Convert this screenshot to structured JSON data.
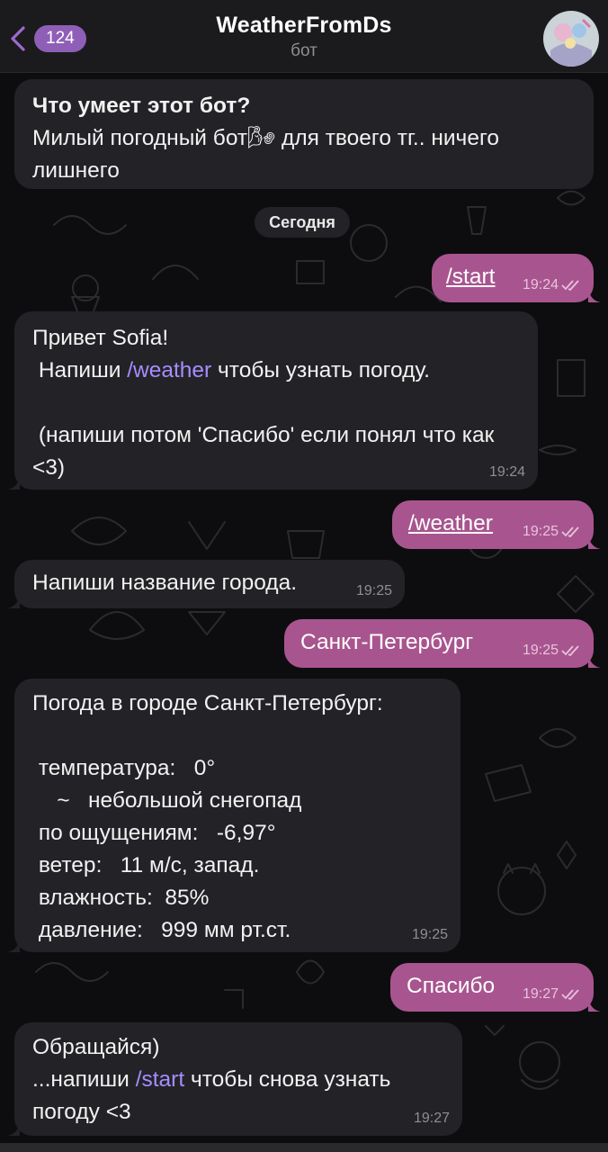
{
  "header": {
    "back_count": "124",
    "title": "WeatherFromDs",
    "subtitle": "бот"
  },
  "intro": {
    "heading": "Что умеет этот бот?",
    "text": "Милый погодный бот🌬 для твоего тг.. ничего лишнего"
  },
  "date_separator": "Сегодня",
  "messages": [
    {
      "direction": "out",
      "text": "/start",
      "time": "19:24",
      "status": "read"
    },
    {
      "direction": "in",
      "text_a": "Привет Sofia!\n Напиши ",
      "link": "/weather",
      "text_b": " чтобы узнать погоду.\n\n (напиши потом 'Спасибо' если понял что как <3)",
      "time": "19:24"
    },
    {
      "direction": "out",
      "text": "/weather",
      "time": "19:25",
      "status": "read"
    },
    {
      "direction": "in",
      "text": "Напиши название города.",
      "time": "19:25"
    },
    {
      "direction": "out",
      "text": "Санкт-Петербург",
      "time": "19:25",
      "status": "read"
    },
    {
      "direction": "in",
      "text": "Погода в городе Санкт-Петербург:\n\n температура:   0°\n    ~   небольшой снегопад\n по ощущениям:   -6,97°\n ветер:   11 м/с, запад.\n влажность:  85%\n давление:   999 мм рт.ст.",
      "time": "19:25"
    },
    {
      "direction": "out",
      "text": "Спасибо",
      "time": "19:27",
      "status": "read"
    },
    {
      "direction": "in",
      "text_a": "Обращайся)\n...напиши ",
      "link": "/start",
      "text_b": " чтобы снова узнать погоду <3",
      "time": "19:27"
    }
  ],
  "colors": {
    "background": "#0d0d0f",
    "header": "#1b1b1d",
    "incoming_bubble": "#232327",
    "outgoing_bubble": "#a8558f",
    "accent": "#8f5fb8",
    "link": "#a68cff"
  }
}
